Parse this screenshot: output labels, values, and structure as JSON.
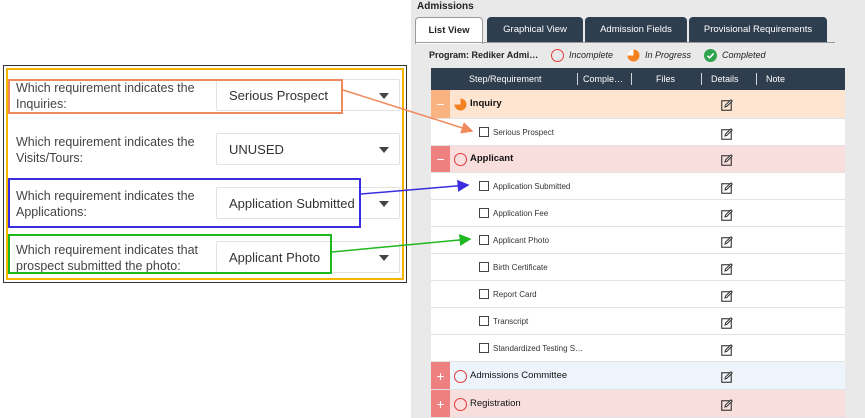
{
  "settings": {
    "rows": [
      {
        "question": "Which requirement indicates the Inquiries:",
        "value": "Serious Prospect"
      },
      {
        "question": "Which requirement indicates the Visits/Tours:",
        "value": "UNUSED"
      },
      {
        "question": "Which requirement indicates the Applications:",
        "value": "Application Submitted"
      },
      {
        "question": "Which requirement indicates that prospect submitted the photo:",
        "value": "Applicant Photo"
      }
    ]
  },
  "admissions": {
    "title": "Admissions",
    "tabs": [
      "List View",
      "Graphical View",
      "Admission Fields",
      "Provisional Requirements"
    ],
    "legend": {
      "program_label": "Program: Rediker Admi…",
      "incomplete": "Incomplete",
      "in_progress": "In Progress",
      "completed": "Completed"
    },
    "columns": [
      "Step/Requirement",
      "Comple…",
      "Files",
      "Details",
      "Note"
    ],
    "rows": [
      {
        "kind": "step",
        "name": "Inquiry",
        "toggle": "−",
        "status": "in_progress"
      },
      {
        "kind": "sub",
        "name": "Serious Prospect"
      },
      {
        "kind": "step",
        "name": "Applicant",
        "toggle": "−",
        "status": "incomplete"
      },
      {
        "kind": "sub",
        "name": "Application Submitted"
      },
      {
        "kind": "sub",
        "name": "Application Fee"
      },
      {
        "kind": "sub",
        "name": "Applicant Photo"
      },
      {
        "kind": "sub",
        "name": "Birth Certificate"
      },
      {
        "kind": "sub",
        "name": "Report Card"
      },
      {
        "kind": "sub",
        "name": "Transcript"
      },
      {
        "kind": "sub",
        "name": "Standardized Testing S…"
      },
      {
        "kind": "step",
        "name": "Admissions Committee",
        "toggle": "+",
        "status": "incomplete"
      },
      {
        "kind": "step",
        "name": "Registration",
        "toggle": "+",
        "status": "incomplete"
      }
    ]
  },
  "colors": {
    "tab_dark": "#2f3e4e",
    "highlight_orange": "#f08a5d",
    "highlight_purple": "#3a2ee0",
    "highlight_green": "#1fb81f",
    "settings_border": "#f5b400",
    "incomplete_red": "#e23b3b",
    "in_progress_orange": "#f58220",
    "completed_green": "#2ea44f"
  }
}
